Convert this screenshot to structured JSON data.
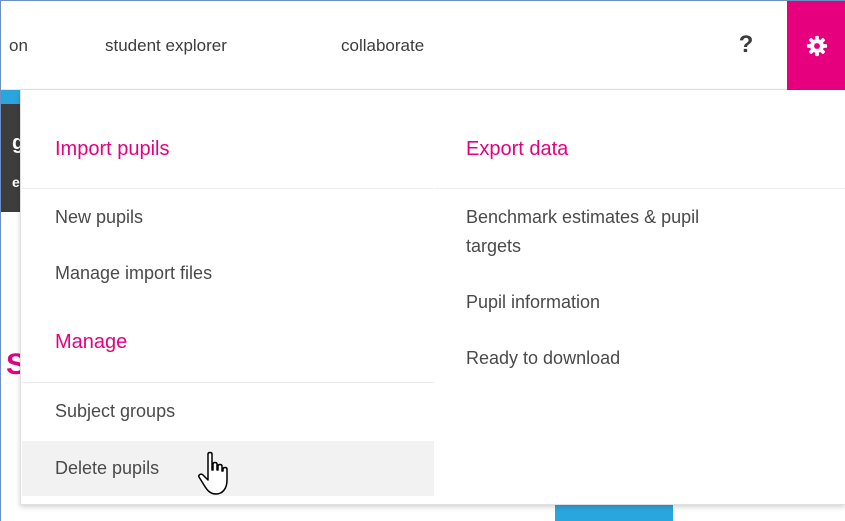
{
  "nav": {
    "partial_item": "on",
    "student_explorer": "student explorer",
    "collaborate": "collaborate",
    "help": "?"
  },
  "background": {
    "partial_letters": [
      "g",
      "er"
    ],
    "partial_heading": "S"
  },
  "dropdown": {
    "import": {
      "heading": "Import pupils",
      "items": [
        "New pupils",
        "Manage import files"
      ]
    },
    "manage": {
      "heading": "Manage",
      "items": [
        "Subject groups",
        "Delete pupils"
      ]
    },
    "export": {
      "heading": "Export data",
      "items": [
        "Benchmark estimates & pupil",
        "targets",
        "Pupil information",
        "Ready to download"
      ]
    }
  },
  "colors": {
    "accent": "#e6007e",
    "secondary": "#2aa6de",
    "hover": "#f2f2f2"
  },
  "icons": {
    "settings": "gear-icon",
    "cursor": "hand-pointer-icon"
  }
}
